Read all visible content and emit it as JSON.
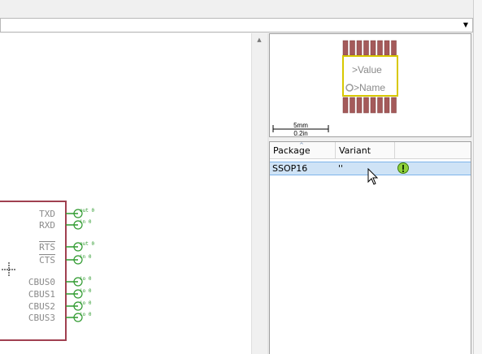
{
  "symbol": {
    "pins": [
      "TXD",
      "RXD",
      "RTS",
      "CTS",
      "CBUS0",
      "CBUS1",
      "CBUS2",
      "CBUS3"
    ],
    "pin_markers": [
      "out 0",
      "in 0",
      "out 0",
      "in 0",
      "io 0",
      "io 0",
      "io 0",
      "io 0"
    ]
  },
  "preview": {
    "value_label": ">Value",
    "name_label": ">Name",
    "scale_mm": "5mm",
    "scale_in": "0.2in"
  },
  "grid": {
    "columns": [
      "Package",
      "Variant"
    ],
    "rows": [
      {
        "package": "SSOP16",
        "variant": "''"
      }
    ]
  },
  "colors": {
    "symbol_outline": "#a04050",
    "pin_green": "#2f9a2f",
    "pin_label_gray": "#8a8a8a",
    "pad_red": "#a45a5a",
    "body_yellow": "#d8c800",
    "selection_blue": "#cfe3f6",
    "warning_green": "#8fd13a"
  },
  "icons": [
    "chevron-down-icon",
    "scroll-up-arrow-icon",
    "sort-up-icon",
    "warning-icon",
    "mouse-cursor-icon",
    "crosshair-icon"
  ]
}
